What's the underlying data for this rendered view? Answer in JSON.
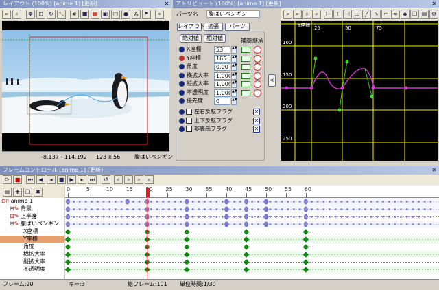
{
  "layout_panel": {
    "title": "レイアウト (100%) [anime 1] [更新]",
    "coords": "-8,137 - 114,192",
    "size": "123 x 56",
    "part_name": "腹ばいペンギン"
  },
  "attr_panel": {
    "title": "アトリビュート (100%) [anime 1] [更新]",
    "part_label": "パーツ名",
    "part_value": "腹ばいペンギン",
    "tabs": [
      "レイアウト",
      "拡張",
      "パーツ"
    ],
    "mode": [
      "絶対値",
      "相対値"
    ],
    "head_interp": "補間",
    "head_inherit": "継承",
    "rows": [
      {
        "label": "X座標",
        "value": "53"
      },
      {
        "label": "Y座標",
        "value": "165"
      },
      {
        "label": "角度",
        "value": "0.00"
      },
      {
        "label": "横拡大率",
        "value": "1.000"
      },
      {
        "label": "縦拡大率",
        "value": "1.000"
      },
      {
        "label": "不透明度",
        "value": "1.000"
      },
      {
        "label": "優先度",
        "value": "0"
      }
    ],
    "flags": [
      "左右反転フラグ",
      "上下反転フラグ",
      "非表示フラグ"
    ]
  },
  "graph": {
    "series_label": "Y座標",
    "x_ticks": [
      "25",
      "50",
      "75"
    ],
    "y_ticks": [
      "100",
      "150",
      "200",
      "250"
    ]
  },
  "frame_panel": {
    "title": "フレームコントロール [anime 1] [更新]",
    "ruler": [
      "0",
      "5",
      "10",
      "15",
      "20",
      "25",
      "30",
      "35",
      "40",
      "45",
      "50",
      "55",
      "60"
    ],
    "tracks": [
      "anime 1",
      "背景",
      "上半身",
      "腹ばいペンギン",
      "X座標",
      "Y座標",
      "角度",
      "横拡大率",
      "縦拡大率",
      "不透明度"
    ],
    "status": {
      "frame": "フレーム:20",
      "key": "キー:3",
      "total": "総フレーム:101",
      "unit": "単位時間:1/30"
    }
  },
  "colors": {
    "accent": "#7c8fbd",
    "graph_bg": "#000000",
    "curve": "#cc33cc",
    "key_green": "#00aa00",
    "selection": "#e8a070"
  }
}
